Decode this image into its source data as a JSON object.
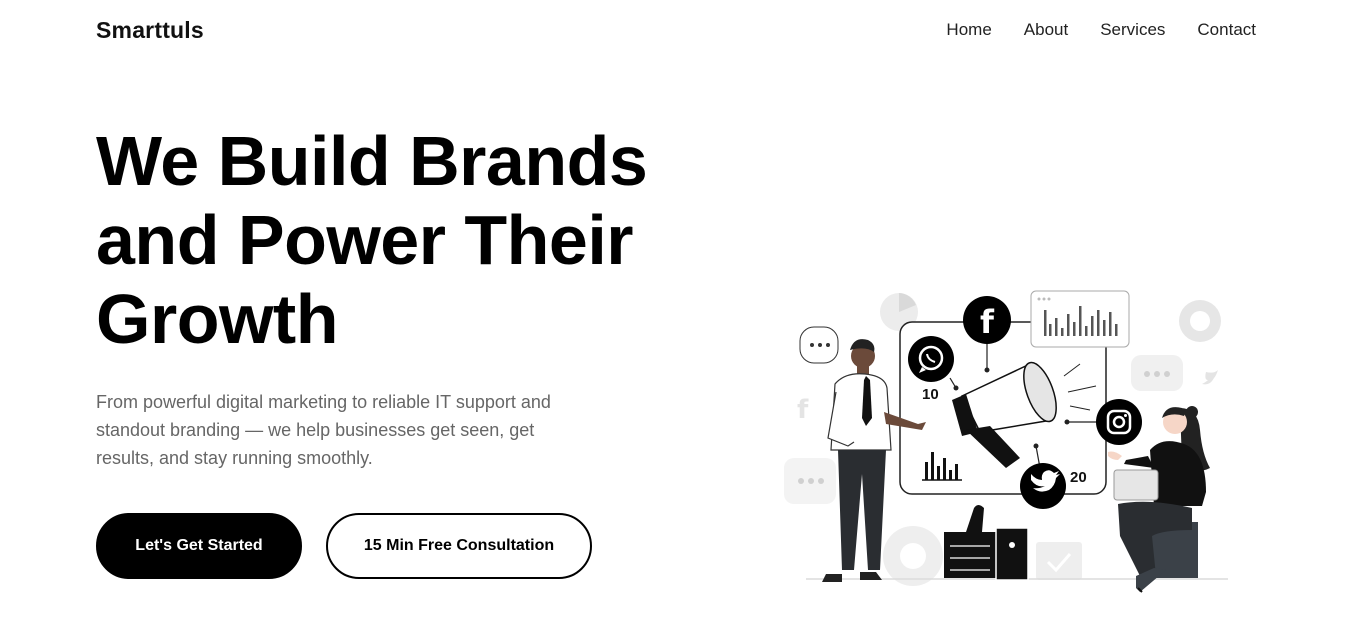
{
  "header": {
    "brand": "Smarttuls",
    "nav": [
      {
        "label": "Home"
      },
      {
        "label": "About"
      },
      {
        "label": "Services"
      },
      {
        "label": "Contact"
      }
    ]
  },
  "hero": {
    "title_lines": [
      "We Build Brands",
      "and Power Their",
      "Growth"
    ],
    "subtitle": "From powerful digital marketing to reliable IT support and standout branding — we help businesses get seen, get results, and stay running smoothly.",
    "primary_button": "Let's Get Started",
    "secondary_button": "15 Min Free Consultation"
  },
  "illustration": {
    "icons": [
      "facebook-icon",
      "whatsapp-icon",
      "instagram-icon",
      "twitter-icon",
      "megaphone-icon",
      "thumbs-up-icon",
      "bar-chart-icon",
      "pie-chart-icon",
      "laptop-icon"
    ],
    "stats": [
      "10",
      "20"
    ],
    "accent": "#000000",
    "muted": "#e8e8e8"
  }
}
